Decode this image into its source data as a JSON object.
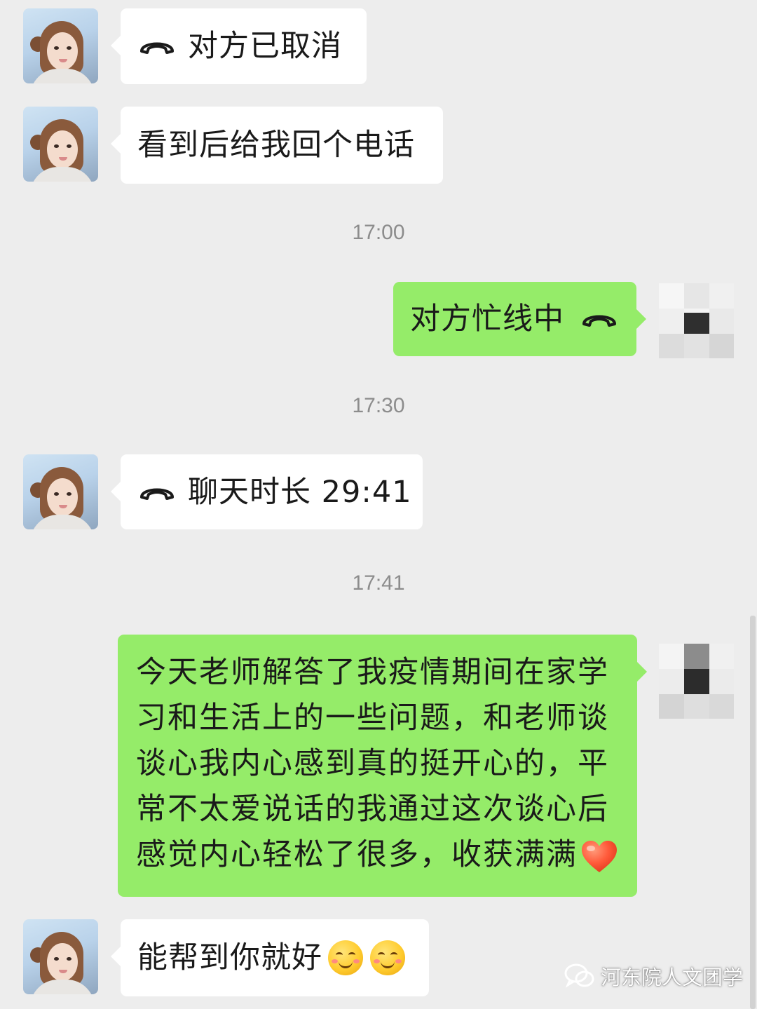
{
  "messages": [
    {
      "label": "对方已取消"
    },
    {
      "label": "看到后给我回个电话"
    },
    {
      "label": "对方忙线中"
    },
    {
      "label": "聊天时长 29:41"
    },
    {
      "text": "今天老师解答了我疫情期间在家学习和生活上的一些问题，和老师谈谈心我内心感到真的挺开心的，平常不太爱说话的我通过这次谈心后感觉内心轻松了很多，收获满满"
    },
    {
      "text": "能帮到你就好"
    }
  ],
  "timestamps": [
    "17:00",
    "17:30",
    "17:41"
  ],
  "icons": {
    "call": "phone-hangup-icon",
    "heart": "red-heart-emoji",
    "smile": "blushing-smile-emoji"
  },
  "colors": {
    "background": "#ededed",
    "incoming_bubble": "#ffffff",
    "outgoing_bubble": "#95ec69",
    "timestamp": "#8c8c8c"
  },
  "watermark": {
    "text": "河东院人文团学"
  }
}
